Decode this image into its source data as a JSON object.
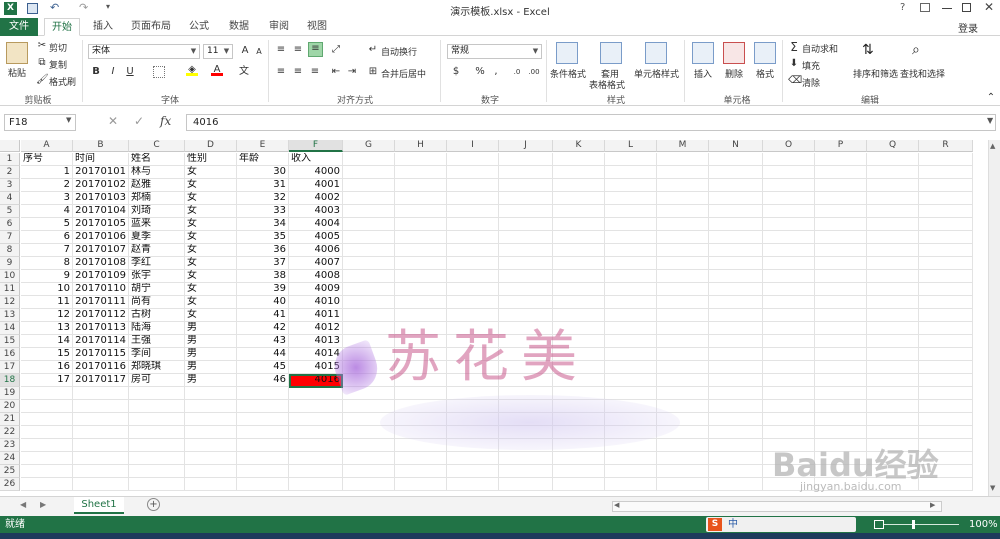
{
  "window": {
    "title": "演示模板.xlsx - Excel",
    "help": "?",
    "login": "登录"
  },
  "ribbon_tabs": [
    {
      "label": "文件"
    },
    {
      "label": "开始"
    },
    {
      "label": "插入"
    },
    {
      "label": "页面布局"
    },
    {
      "label": "公式"
    },
    {
      "label": "数据"
    },
    {
      "label": "审阅"
    },
    {
      "label": "视图"
    }
  ],
  "clipboard": {
    "paste": "粘贴",
    "cut": "剪切",
    "copy": "复制",
    "format_painter": "格式刷",
    "group": "剪贴板"
  },
  "font": {
    "name": "宋体",
    "size": "11",
    "bold": "B",
    "italic": "I",
    "underline": "U",
    "group": "字体"
  },
  "alignment": {
    "wrap": "自动换行",
    "merge": "合并后居中",
    "group": "对齐方式"
  },
  "number": {
    "format": "常规",
    "percent": "%",
    "group": "数字"
  },
  "styles": {
    "conditional": "条件格式",
    "table_format_1": "套用",
    "table_format_2": "表格格式",
    "cell_styles": "单元格样式",
    "group": "样式"
  },
  "cells": {
    "insert": "插入",
    "delete": "删除",
    "format": "格式",
    "group": "单元格"
  },
  "editing": {
    "autosum": "自动求和",
    "fill": "填充",
    "clear": "清除",
    "sort": "排序和筛选",
    "find": "查找和选择",
    "group": "编辑"
  },
  "formula_bar": {
    "name_box": "F18",
    "fx": "fx",
    "value": "4016"
  },
  "columns": [
    "A",
    "B",
    "C",
    "D",
    "E",
    "F",
    "G",
    "H",
    "I",
    "J",
    "K",
    "L",
    "M",
    "N",
    "O",
    "P",
    "Q",
    "R"
  ],
  "rows": [
    "1",
    "2",
    "3",
    "4",
    "5",
    "6",
    "7",
    "8",
    "9",
    "10",
    "11",
    "12",
    "13",
    "14",
    "15",
    "16",
    "17",
    "18",
    "19",
    "20",
    "21",
    "22",
    "23",
    "24",
    "25",
    "26"
  ],
  "headers": [
    "序号",
    "时间",
    "姓名",
    "性别",
    "年龄",
    "收入"
  ],
  "table": [
    [
      "1",
      "20170101",
      "林与",
      "女",
      "30",
      "4000"
    ],
    [
      "2",
      "20170102",
      "赵雅",
      "女",
      "31",
      "4001"
    ],
    [
      "3",
      "20170103",
      "郑楠",
      "女",
      "32",
      "4002"
    ],
    [
      "4",
      "20170104",
      "刘琦",
      "女",
      "33",
      "4003"
    ],
    [
      "5",
      "20170105",
      "蓝来",
      "女",
      "34",
      "4004"
    ],
    [
      "6",
      "20170106",
      "夏季",
      "女",
      "35",
      "4005"
    ],
    [
      "7",
      "20170107",
      "赵青",
      "女",
      "36",
      "4006"
    ],
    [
      "8",
      "20170108",
      "李红",
      "女",
      "37",
      "4007"
    ],
    [
      "9",
      "20170109",
      "张宇",
      "女",
      "38",
      "4008"
    ],
    [
      "10",
      "20170110",
      "胡宁",
      "女",
      "39",
      "4009"
    ],
    [
      "11",
      "20170111",
      "尚有",
      "女",
      "40",
      "4010"
    ],
    [
      "12",
      "20170112",
      "古树",
      "女",
      "41",
      "4011"
    ],
    [
      "13",
      "20170113",
      "陆海",
      "男",
      "42",
      "4012"
    ],
    [
      "14",
      "20170114",
      "王强",
      "男",
      "43",
      "4013"
    ],
    [
      "15",
      "20170115",
      "李间",
      "男",
      "44",
      "4014"
    ],
    [
      "16",
      "20170116",
      "郑晓琪",
      "男",
      "45",
      "4015"
    ],
    [
      "17",
      "20170117",
      "房可",
      "男",
      "46",
      "4016"
    ]
  ],
  "watermark": {
    "text": "苏花美",
    "baidu": "Baidu经验",
    "url": "jingyan.baidu.com"
  },
  "sheet_tab": "Sheet1",
  "status": {
    "ready": "就绪",
    "zoom": "100%",
    "ime": "中"
  },
  "colors": {
    "excel_green": "#217346",
    "highlight": "#ff0000"
  }
}
